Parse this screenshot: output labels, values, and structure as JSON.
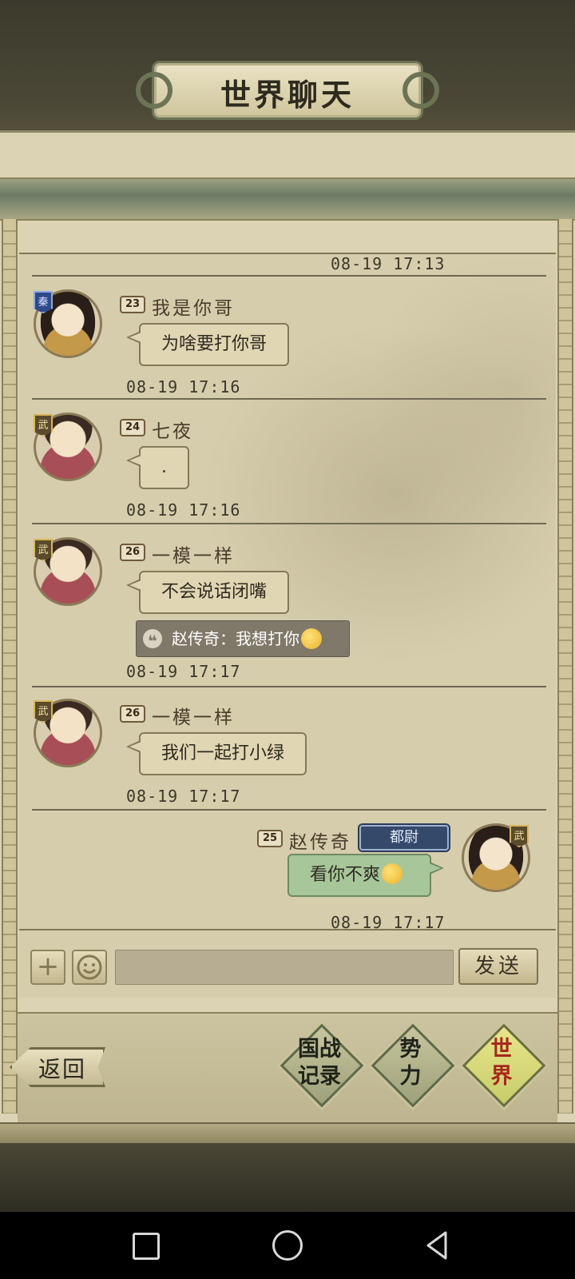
{
  "header": {
    "title": "世界聊天"
  },
  "chat": {
    "top_timestamp": "08-19 17:13",
    "messages": [
      {
        "level": "23",
        "badge": "秦",
        "name": "我是你哥",
        "text": "为啥要打你哥",
        "time": "08-19 17:16"
      },
      {
        "level": "24",
        "badge": "武",
        "name": "七夜",
        "text": ".",
        "time": "08-19 17:16"
      },
      {
        "level": "26",
        "badge": "武",
        "name": "一模一样",
        "text": "不会说话闭嘴",
        "quote": "赵传奇：我想打你",
        "time": "08-19 17:17"
      },
      {
        "level": "26",
        "badge": "武",
        "name": "一模一样",
        "text": "我们一起打小绿",
        "time": "08-19 17:17"
      },
      {
        "level": "25",
        "badge": "武",
        "name": "赵传奇",
        "title": "都尉",
        "text": "看你不爽",
        "time": "08-19 17:17"
      }
    ]
  },
  "input": {
    "value": "",
    "send_label": "发送"
  },
  "footer": {
    "back_label": "返回",
    "tabs": [
      {
        "label": "国战\n记录"
      },
      {
        "label": "势\n力"
      },
      {
        "label": "世\n界"
      }
    ],
    "active_tab": "世界"
  },
  "colors": {
    "self_bubble": "#a7c69a",
    "active_tab_text": "#a8261d",
    "panel": "#d6cdac"
  }
}
